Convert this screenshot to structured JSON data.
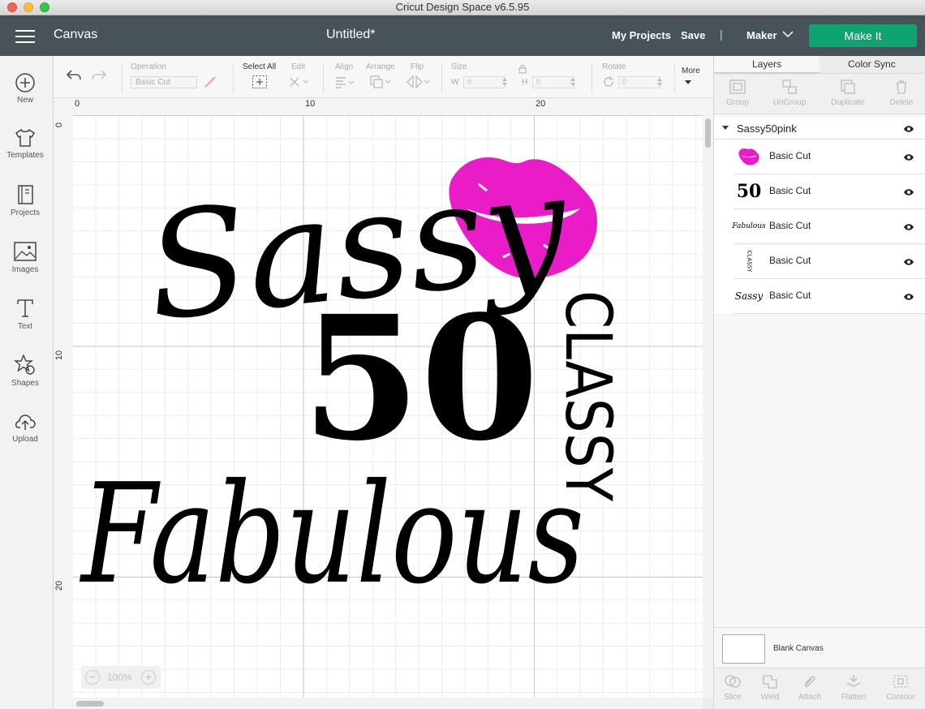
{
  "window": {
    "title": "Cricut Design Space  v6.5.95"
  },
  "header": {
    "section": "Canvas",
    "document_title": "Untitled*",
    "my_projects": "My Projects",
    "save": "Save",
    "separator": "|",
    "machine": "Maker",
    "make_it": "Make It",
    "make_it_color": "#0ea36f",
    "bar_color": "#485259"
  },
  "leftnav": [
    {
      "label": "New",
      "icon": "plus-circle-icon"
    },
    {
      "label": "Templates",
      "icon": "tshirt-icon"
    },
    {
      "label": "Projects",
      "icon": "book-icon"
    },
    {
      "label": "Images",
      "icon": "image-icon"
    },
    {
      "label": "Text",
      "icon": "text-t-icon"
    },
    {
      "label": "Shapes",
      "icon": "shapes-icon"
    },
    {
      "label": "Upload",
      "icon": "cloud-upload-icon"
    }
  ],
  "toolbar": {
    "operation_label": "Operation",
    "operation_value": "Basic Cut",
    "select_all": "Select All",
    "edit": "Edit",
    "align": "Align",
    "arrange": "Arrange",
    "flip": "Flip",
    "size": "Size",
    "w": "W",
    "w_value": "0",
    "h": "H",
    "h_value": "0",
    "rotate": "Rotate",
    "rotate_value": "0",
    "more": "More"
  },
  "rulers": {
    "top": [
      "0",
      "10",
      "20"
    ],
    "left": [
      "0",
      "10",
      "20"
    ]
  },
  "canvas_art": {
    "sassy": "Sassy",
    "fifty": "50",
    "classy": "CLASSY",
    "fabulous": "Fabulous",
    "lips_color": "#e91cc8",
    "ink_color": "#000000"
  },
  "zoom": {
    "minus": "−",
    "value": "100%",
    "plus": "+"
  },
  "right_panel": {
    "tabs": [
      "Layers",
      "Color Sync"
    ],
    "actions": [
      "Group",
      "UnGroup",
      "Duplicate",
      "Delete"
    ],
    "group_name": "Sassy50pink",
    "layers": [
      {
        "thumb": "lips",
        "name": "Basic Cut"
      },
      {
        "thumb": "50",
        "name": "Basic Cut"
      },
      {
        "thumb": "Fabulous",
        "name": "Basic Cut"
      },
      {
        "thumb": "CLASSY",
        "name": "Basic Cut"
      },
      {
        "thumb": "Sassy",
        "name": "Basic Cut"
      }
    ],
    "blank_canvas": "Blank Canvas",
    "bottom_actions": [
      "Slice",
      "Weld",
      "Attach",
      "Flatten",
      "Contour"
    ]
  }
}
